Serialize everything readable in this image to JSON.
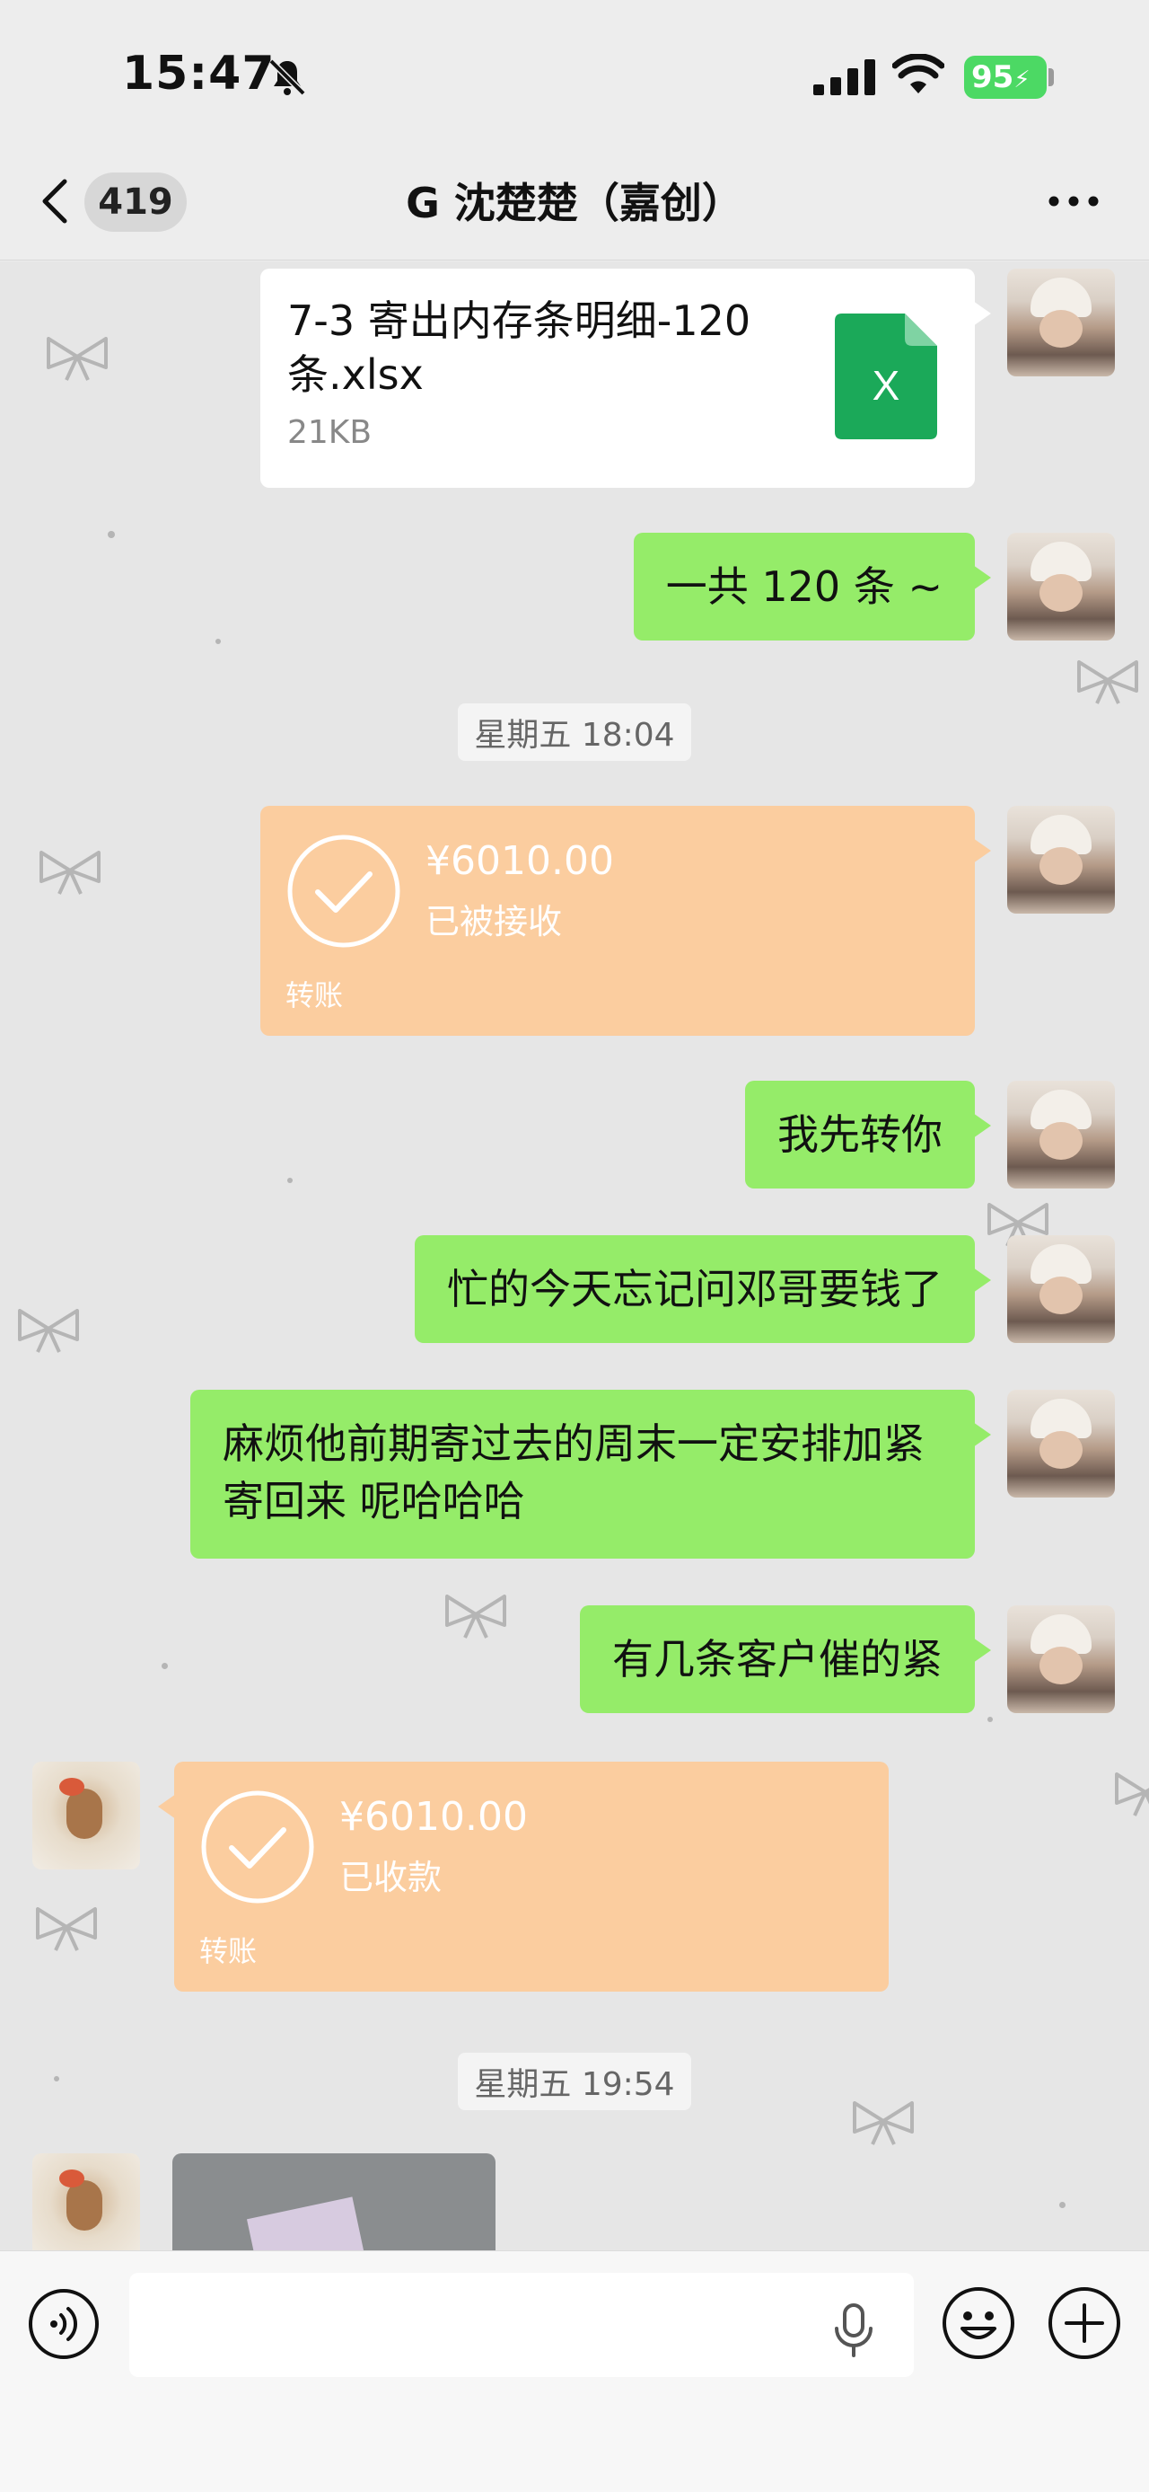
{
  "status_bar": {
    "time": "15:47",
    "battery": "95"
  },
  "nav": {
    "unread_count": "419",
    "title": "G 沈楚楚（嘉创）"
  },
  "messages": {
    "file": {
      "name": "7-3 寄出内存条明细-120条.xlsx",
      "size": "21KB",
      "icon_letter": "X"
    },
    "msg_total": "一共 120 条 ~",
    "time1": "星期五 18:04",
    "transfer_sent": {
      "amount": "¥6010.00",
      "status": "已被接收",
      "label": "转账"
    },
    "msg_pay_first": "我先转你",
    "msg_forgot": "忙的今天忘记问邓哥要钱了",
    "msg_trouble": "麻烦他前期寄过去的周末一定安排加紧寄回来 呢哈哈哈",
    "msg_urgent": "有几条客户催的紧",
    "transfer_received": {
      "amount": "¥6010.00",
      "status": "已收款",
      "label": "转账"
    },
    "time2": "星期五 19:54"
  },
  "input": {
    "placeholder": ""
  },
  "colors": {
    "bubble_green": "#95ec69",
    "transfer_orange": "#fbcd9f",
    "excel_green": "#1ba959",
    "battery_green": "#4cd964"
  },
  "icons": [
    "bell-off-icon",
    "signal-icon",
    "wifi-icon",
    "back-icon",
    "more-icon",
    "excel-file-icon",
    "check-circle-icon",
    "voice-icon",
    "mic-icon",
    "emoji-icon",
    "plus-icon",
    "bow-decoration"
  ]
}
